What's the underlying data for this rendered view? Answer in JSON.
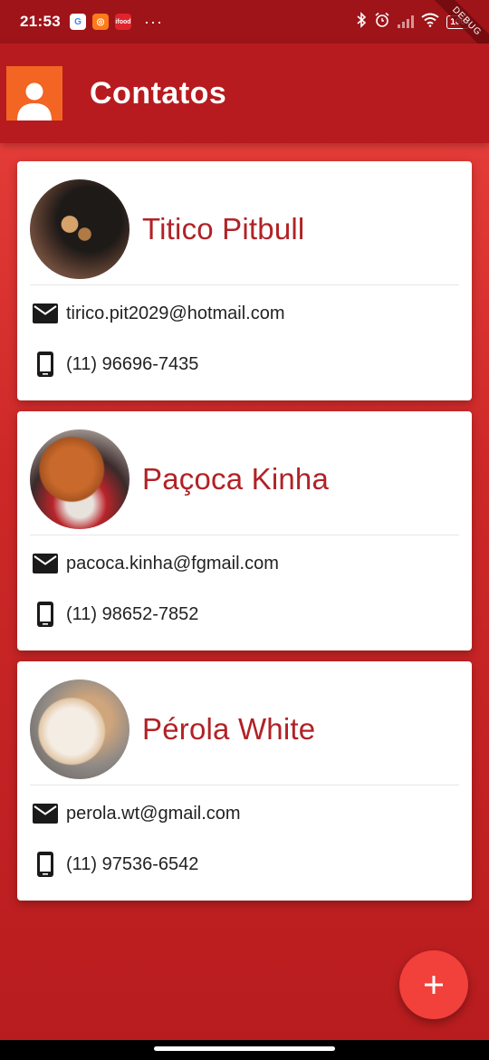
{
  "status_bar": {
    "time": "21:53",
    "app_icons": [
      "G",
      "◎",
      "ifood"
    ],
    "overflow": "···",
    "battery": "100",
    "debug_banner": "DEBUG"
  },
  "app_bar": {
    "title": "Contatos",
    "icon": "person-icon",
    "logo_color": "#f26522",
    "bar_color": "#b71b1f"
  },
  "contacts": [
    {
      "name": "Titico Pitbull",
      "email": "tirico.pit2029@hotmail.com",
      "phone": "(11) 96696-7435",
      "photo": "black-dog-photo"
    },
    {
      "name": "Paçoca Kinha",
      "email": "pacoca.kinha@fgmail.com",
      "phone": "(11) 98652-7852",
      "photo": "brown-dog-photo"
    },
    {
      "name": "Pérola White",
      "email": "perola.wt@gmail.com",
      "phone": "(11) 97536-6542",
      "photo": "white-dog-photo"
    }
  ],
  "fab": {
    "label": "+",
    "color": "#f2403b"
  },
  "colors": {
    "accent": "#b12226",
    "background": "#cd2828"
  }
}
